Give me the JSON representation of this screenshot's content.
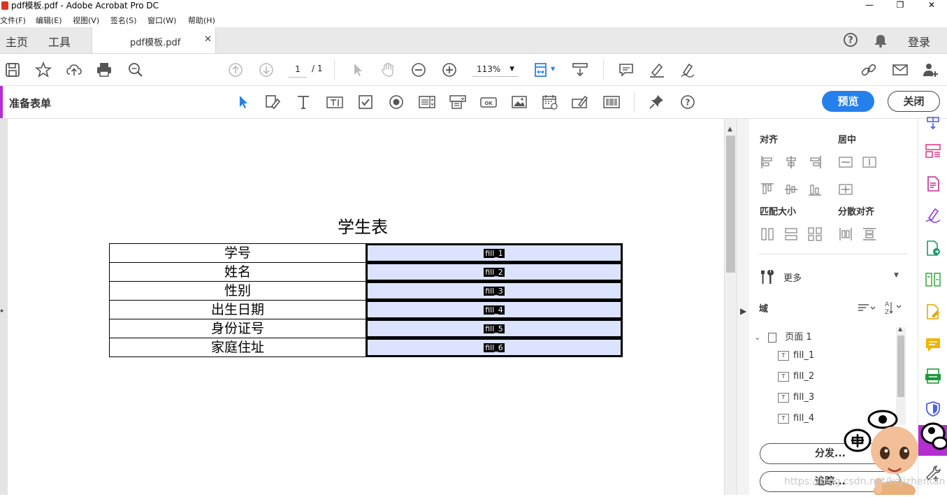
{
  "window": {
    "title": "pdf模板.pdf - Adobe Acrobat Pro DC",
    "controls": [
      "—",
      "❐",
      "✕"
    ]
  },
  "menu": [
    "文件(F)",
    "编辑(E)",
    "视图(V)",
    "签名(S)",
    "窗口(W)",
    "帮助(H)"
  ],
  "tabs": {
    "home": "主页",
    "tools": "工具",
    "document": "pdf模板.pdf",
    "login": "登录"
  },
  "toolbar": {
    "page_current": "1",
    "page_total": "/ 1",
    "zoom": "113%"
  },
  "form_bar": {
    "title": "准备表单",
    "preview": "预览",
    "close": "关闭"
  },
  "document": {
    "title": "学生表",
    "rows": [
      {
        "label": "学号",
        "field": "fill_1"
      },
      {
        "label": "姓名",
        "field": "fill_2"
      },
      {
        "label": "性别",
        "field": "fill_3"
      },
      {
        "label": "出生日期",
        "field": "fill_4"
      },
      {
        "label": "身份证号",
        "field": "fill_5"
      },
      {
        "label": "家庭住址",
        "field": "fill_6"
      }
    ]
  },
  "right_panel": {
    "align": "对齐",
    "center": "居中",
    "match_size": "匹配大小",
    "distribute": "分散对齐",
    "more": "更多",
    "fields": "域",
    "page_node": "页面 1",
    "tree_fields": [
      "fill_1",
      "fill_2",
      "fill_3",
      "fill_4"
    ],
    "distribute_btn": "分发...",
    "track_btn": "追踪..."
  },
  "watermark": "https://blog.csdn.net/kejizhentan",
  "colors": {
    "accent_purple": "#b42fd1",
    "preview_blue": "#2680eb",
    "field_fill": "#dbe3ff"
  }
}
